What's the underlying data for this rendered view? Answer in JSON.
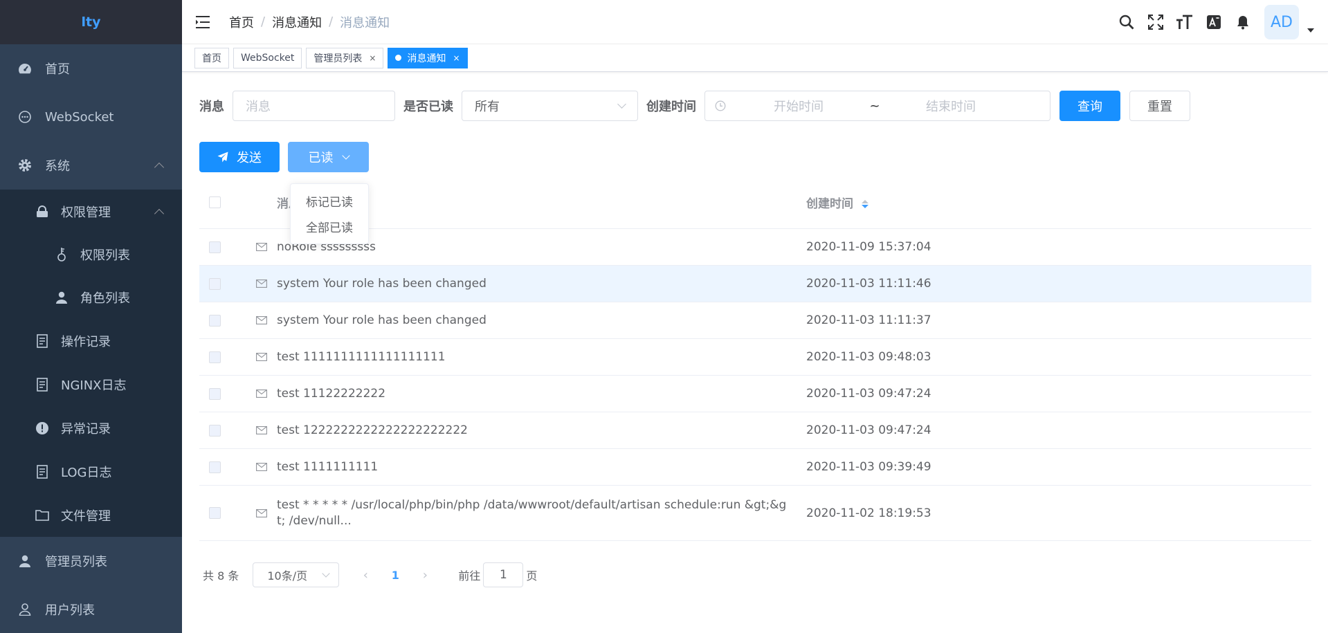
{
  "app": {
    "logo_text": "lty"
  },
  "sidebar": {
    "items": [
      {
        "label": "首页",
        "icon": "dashboard-icon"
      },
      {
        "label": "WebSocket",
        "icon": "chat-icon"
      },
      {
        "label": "系统",
        "icon": "gear-icon"
      }
    ],
    "system_children": {
      "permission_group": {
        "label": "权限管理",
        "icon": "lock-icon"
      },
      "permission_children": [
        {
          "label": "权限列表",
          "icon": "key-icon"
        },
        {
          "label": "角色列表",
          "icon": "user-icon"
        }
      ],
      "others": [
        {
          "label": "操作记录",
          "icon": "document-icon"
        },
        {
          "label": "NGINX日志",
          "icon": "document-icon"
        },
        {
          "label": "异常记录",
          "icon": "warning-icon"
        },
        {
          "label": "LOG日志",
          "icon": "document-icon"
        },
        {
          "label": "文件管理",
          "icon": "folder-icon"
        }
      ]
    },
    "bottom": [
      {
        "label": "管理员列表",
        "icon": "user-icon"
      },
      {
        "label": "用户列表",
        "icon": "user-outline-icon"
      }
    ]
  },
  "header": {
    "breadcrumb": [
      "首页",
      "消息通知",
      "消息通知"
    ],
    "avatar_text": "AD"
  },
  "tags": [
    {
      "label": "首页",
      "closable": false
    },
    {
      "label": "WebSocket",
      "closable": false
    },
    {
      "label": "管理员列表",
      "closable": true,
      "close": "×"
    },
    {
      "label": "消息通知",
      "closable": true,
      "active": true,
      "close": "×"
    }
  ],
  "filter": {
    "message_label": "消息",
    "message_placeholder": "消息",
    "read_label": "是否已读",
    "read_value": "所有",
    "time_label": "创建时间",
    "start_placeholder": "开始时间",
    "range_sep": "~",
    "end_placeholder": "结束时间",
    "query_label": "查询",
    "reset_label": "重置"
  },
  "actions": {
    "send_label": "发送",
    "read_label": "已读",
    "dropdown": [
      "标记已读",
      "全部已读"
    ]
  },
  "table": {
    "headers": {
      "message": "消息",
      "created": "创建时间"
    },
    "rows": [
      {
        "message": "noRole sssssssss",
        "created": "2020-11-09 15:37:04"
      },
      {
        "message": "system Your role has been changed",
        "created": "2020-11-03 11:11:46"
      },
      {
        "message": "system Your role has been changed",
        "created": "2020-11-03 11:11:37"
      },
      {
        "message": "test 1111111111111111111",
        "created": "2020-11-03 09:48:03"
      },
      {
        "message": "test 11122222222",
        "created": "2020-11-03 09:47:24"
      },
      {
        "message": "test 1222222222222222222222",
        "created": "2020-11-03 09:47:24"
      },
      {
        "message": "test 1111111111",
        "created": "2020-11-03 09:39:49"
      },
      {
        "message": "test * * * * * /usr/local/php/bin/php /data/wwwroot/default/artisan schedule:run &gt;&gt; /dev/null...",
        "created": "2020-11-02 18:19:53"
      }
    ]
  },
  "pagination": {
    "total": "共 8 条",
    "page_size": "10条/页",
    "current_page": "1",
    "prev": "‹",
    "next": "›",
    "goto_label": "前往",
    "goto_value": "1",
    "page_unit": "页"
  },
  "colors": {
    "primary": "#1890ff",
    "sidebar_bg": "#304156",
    "submenu_bg": "#1f2d3d"
  }
}
